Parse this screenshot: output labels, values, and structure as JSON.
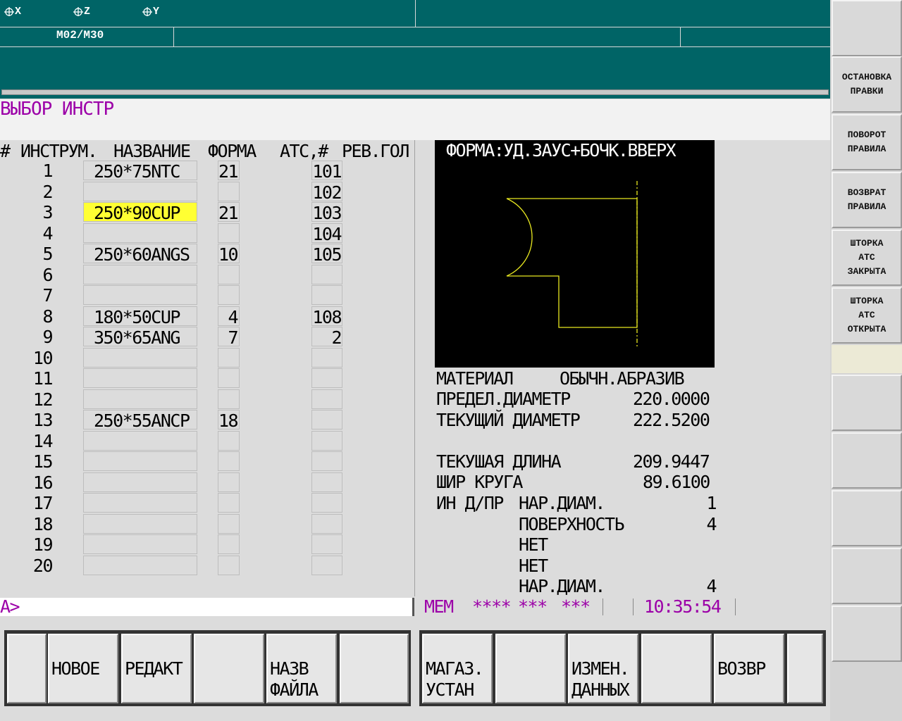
{
  "header": {
    "axes": [
      "X",
      "Z",
      "Y"
    ],
    "mcode": "M02/M30"
  },
  "title": "ВЫБОР ИНСТР",
  "table": {
    "headers": {
      "num": "#",
      "tool": "ИНСТРУМ.",
      "name": "НАЗВАНИЕ",
      "form": "ФОРМА",
      "atc": "АТС,#",
      "rev": "РЕВ.ГОЛ"
    },
    "rows": [
      {
        "n": "1",
        "name": "250*75NTC",
        "form": "21",
        "atc": "101"
      },
      {
        "n": "2",
        "name": "",
        "form": "",
        "atc": "102"
      },
      {
        "n": "3",
        "name": "250*90CUP",
        "form": "21",
        "atc": "103",
        "selected": true
      },
      {
        "n": "4",
        "name": "",
        "form": "",
        "atc": "104"
      },
      {
        "n": "5",
        "name": "250*60ANGS",
        "form": "10",
        "atc": "105"
      },
      {
        "n": "6",
        "name": "",
        "form": "",
        "atc": ""
      },
      {
        "n": "7",
        "name": "",
        "form": "",
        "atc": ""
      },
      {
        "n": "8",
        "name": "180*50CUP",
        "form": " 4",
        "atc": "108"
      },
      {
        "n": "9",
        "name": "350*65ANG",
        "form": " 7",
        "atc": "2"
      },
      {
        "n": "10",
        "name": "",
        "form": "",
        "atc": ""
      },
      {
        "n": "11",
        "name": "",
        "form": "",
        "atc": ""
      },
      {
        "n": "12",
        "name": "",
        "form": "",
        "atc": ""
      },
      {
        "n": "13",
        "name": "250*55ANCP",
        "form": "18",
        "atc": ""
      },
      {
        "n": "14",
        "name": "",
        "form": "",
        "atc": ""
      },
      {
        "n": "15",
        "name": "",
        "form": "",
        "atc": ""
      },
      {
        "n": "16",
        "name": "",
        "form": "",
        "atc": ""
      },
      {
        "n": "17",
        "name": "",
        "form": "",
        "atc": ""
      },
      {
        "n": "18",
        "name": "",
        "form": "",
        "atc": ""
      },
      {
        "n": "19",
        "name": "",
        "form": "",
        "atc": ""
      },
      {
        "n": "20",
        "name": "",
        "form": "",
        "atc": ""
      }
    ]
  },
  "shape": {
    "title": "ФОРМА:УД.ЗАУС+БОЧК.ВВЕРХ"
  },
  "info": {
    "material_label": "МАТЕРИАЛ",
    "material_value": "ОБЫЧН.АБРАЗИВ",
    "limit_diam_label": "ПРЕДЕЛ.ДИАМЕТР",
    "limit_diam_value": "220.0000",
    "cur_diam_label": "ТЕКУЩИЙ ДИАМЕТР",
    "cur_diam_value": "222.5200",
    "cur_len_label": "ТЕКУШАЯ ДЛИНА",
    "cur_len_value": "209.9447",
    "width_label": "ШИР КРУГА",
    "width_value": "89.6100",
    "dress_label": "ИН Д/ПР",
    "dress_rows": [
      {
        "label": "НАР.ДИАМ.",
        "value": "1"
      },
      {
        "label": "ПОВЕРХНОСТЬ",
        "value": "4"
      },
      {
        "label": "НЕТ",
        "value": ""
      },
      {
        "label": "НЕТ",
        "value": ""
      },
      {
        "label": "НАР.ДИАМ.",
        "value": "4"
      }
    ]
  },
  "status": {
    "prompt": "A>",
    "mode": "MEM",
    "s1": "****",
    "s2": "***",
    "s3": "***",
    "time": "10:35:54"
  },
  "softkeys": [
    "",
    "НОВОЕ",
    "РЕДАКТ",
    "",
    "НАЗВ\nФАЙЛА",
    "",
    "МАГАЗ.\nУСТАН",
    "",
    "ИЗМЕН.\nДАННЫХ",
    "",
    "ВОЗВР",
    ""
  ],
  "right_keys": [
    "",
    "ОСТАНОВКА\nПРАВКИ",
    "ПОВОРОТ\nПРАВИЛА",
    "ВОЗВРАТ\nПРАВИЛА",
    "ШТОРКА\nАТС\nЗАКРЫТА",
    "ШТОРКА\nАТС\nОТКРЫТА",
    "",
    "",
    "",
    "",
    ""
  ],
  "colors": {
    "header_bg": "#006466",
    "title_text": "#9c00a8",
    "selected_cell": "#ffff33",
    "shape_line": "#e8e820"
  }
}
